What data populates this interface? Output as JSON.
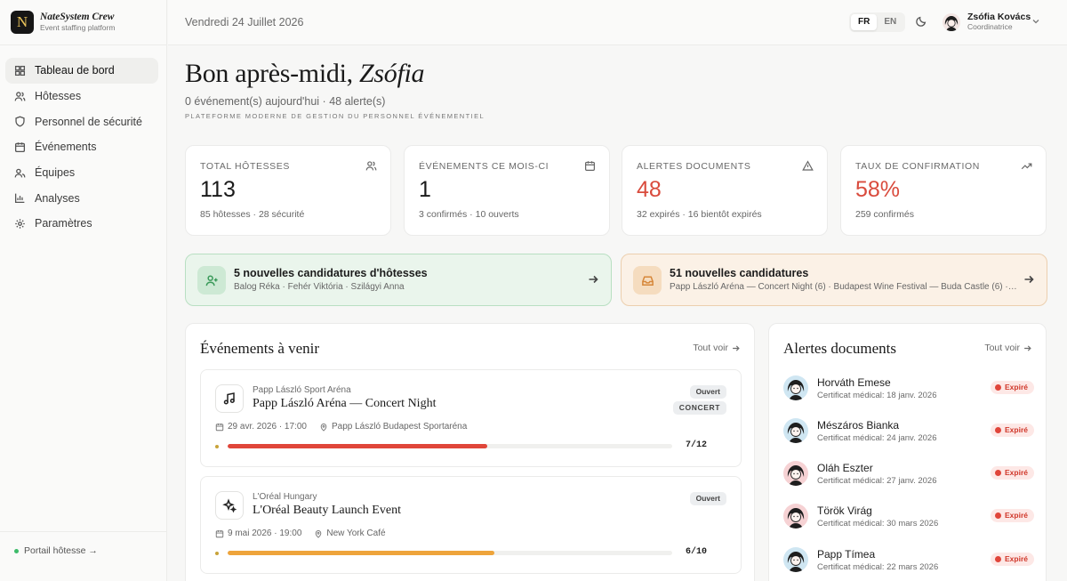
{
  "brand": {
    "name": "NateSystem Crew",
    "tagline": "Event staffing platform",
    "logo_letter": "N"
  },
  "sidebar": {
    "items": [
      {
        "label": "Tableau de bord",
        "icon": "dashboard-icon",
        "active": true
      },
      {
        "label": "Hôtesses",
        "icon": "users-icon"
      },
      {
        "label": "Personnel de sécurité",
        "icon": "shield-icon"
      },
      {
        "label": "Événements",
        "icon": "calendar-icon"
      },
      {
        "label": "Équipes",
        "icon": "team-icon"
      },
      {
        "label": "Analyses",
        "icon": "bar-chart-icon"
      },
      {
        "label": "Paramètres",
        "icon": "gear-icon"
      }
    ],
    "portal_label": "Portail hôtesse →"
  },
  "topbar": {
    "date": "Vendredi 24 Juillet 2026",
    "lang_fr": "FR",
    "lang_en": "EN",
    "user_name": "Zsófia Kovács",
    "user_role": "Coordinatrice"
  },
  "header": {
    "greeting": "Bon après-midi,",
    "greeting_name": "Zsófia",
    "summary": "0 événement(s) aujourd'hui · 48 alerte(s)",
    "kicker": "Plateforme moderne de gestion du personnel événementiel"
  },
  "stats": [
    {
      "label": "Total hôtesses",
      "value": "113",
      "foot": "85 hôtesses · 28 sécurité",
      "icon": "users-icon",
      "accent": "#1a1a1a"
    },
    {
      "label": "Événements ce mois-ci",
      "value": "1",
      "foot": "3 confirmés · 10 ouverts",
      "icon": "calendar-icon",
      "accent": "#1a1a1a"
    },
    {
      "label": "Alertes documents",
      "value": "48",
      "foot": "32 expirés · 16 bientôt expirés",
      "icon": "warning-icon",
      "accent": "#d94b3d"
    },
    {
      "label": "Taux de confirmation",
      "value": "58%",
      "foot": "259 confirmés",
      "icon": "trending-up-icon",
      "accent": "#d94b3d"
    }
  ],
  "banners": {
    "hostesses": {
      "title": "5 nouvelles candidatures d'hôtesses",
      "subtitle": "Balog Réka · Fehér Viktória · Szilágyi Anna"
    },
    "applications": {
      "title": "51 nouvelles candidatures",
      "subtitle": "Papp László Aréna — Concert Night (6) · Budapest Wine Festival — Buda Castle (6) · …"
    }
  },
  "events_panel": {
    "title": "Événements à venir",
    "link": "Tout voir",
    "events": [
      {
        "venue": "Papp László Sport Aréna",
        "title": "Papp László Aréna — Concert Night",
        "datetime": "29 avr. 2026 · 17:00",
        "location": "Papp László Budapest Sportaréna",
        "status": "Ouvert",
        "tag": "CONCERT",
        "count": "7/12",
        "progress": 0.583,
        "bar_color": "#e0463a",
        "icon": "music-note-icon"
      },
      {
        "venue": "L'Oréal Hungary",
        "title": "L'Oréal Beauty Launch Event",
        "datetime": "9 mai 2026 · 19:00",
        "location": "New York Café",
        "status": "Ouvert",
        "tag": "",
        "count": "6/10",
        "progress": 0.6,
        "bar_color": "#eea43b",
        "icon": "sparkles-icon"
      }
    ]
  },
  "alerts_panel": {
    "title": "Alertes documents",
    "link": "Tout voir",
    "alerts": [
      {
        "name": "Horváth Emese",
        "doc": "Certificat médical: 18 janv. 2026",
        "status": "Expiré",
        "avatar_bg": "#cfe6f2"
      },
      {
        "name": "Mészáros Bianka",
        "doc": "Certificat médical: 24 janv. 2026",
        "status": "Expiré",
        "avatar_bg": "#cfe6f2"
      },
      {
        "name": "Oláh Eszter",
        "doc": "Certificat médical: 27 janv. 2026",
        "status": "Expiré",
        "avatar_bg": "#f6d2d4"
      },
      {
        "name": "Török Virág",
        "doc": "Certificat médical: 30 mars 2026",
        "status": "Expiré",
        "avatar_bg": "#f6d2d4"
      },
      {
        "name": "Papp Tímea",
        "doc": "Certificat médical: 22 mars 2026",
        "status": "Expiré",
        "avatar_bg": "#cfe6f2"
      }
    ]
  }
}
